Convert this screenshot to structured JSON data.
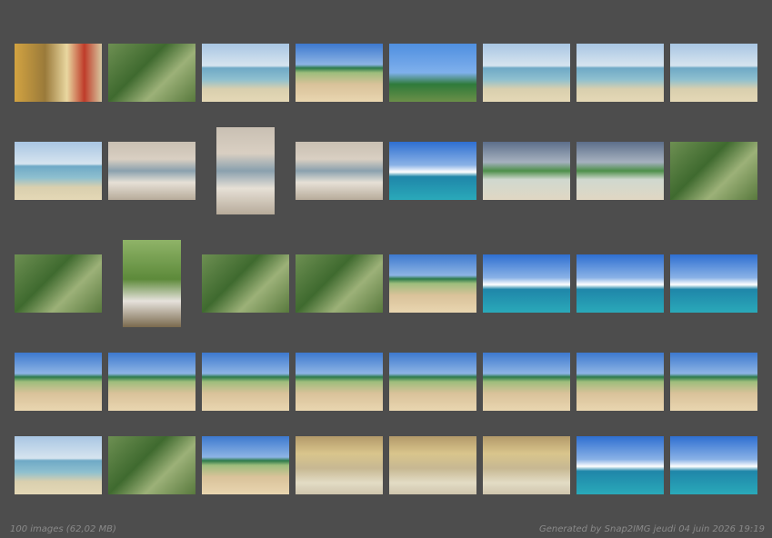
{
  "footer": {
    "count_label": "100 images (62,02 MB)",
    "generated_label": "Generated by Snap2IMG jeudi 04 juin 2026 19:19"
  },
  "rows": [
    [
      "indoor",
      "jungle",
      "sea",
      "beach",
      "palm",
      "sea",
      "sea",
      "sea"
    ],
    [
      "sea",
      "boat",
      "boat",
      "boat",
      "deep-sea",
      "dusk-sea",
      "dusk-sea",
      "jungle"
    ],
    [
      "jungle",
      "portrait-jungle",
      "jungle",
      "jungle",
      "beach",
      "deep-sea",
      "deep-sea",
      "deep-sea"
    ],
    [
      "beach",
      "beach",
      "beach",
      "beach",
      "beach",
      "beach",
      "beach",
      "beach"
    ],
    [
      "sea",
      "jungle",
      "beach",
      "restaurant",
      "restaurant",
      "restaurant",
      "deep-sea",
      "deep-sea"
    ]
  ]
}
